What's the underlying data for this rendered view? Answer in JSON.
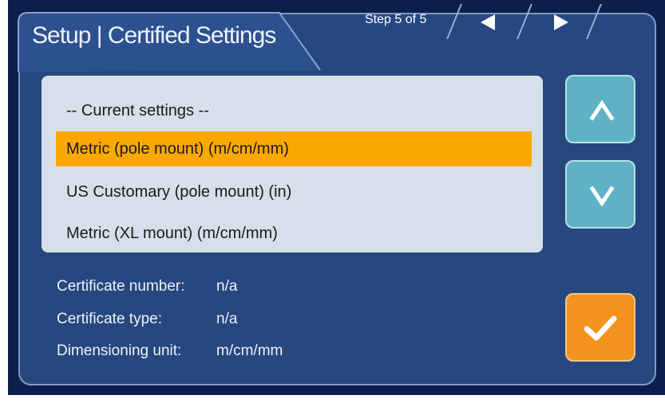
{
  "header": {
    "title": "Setup | Certified Settings",
    "step_indicator": "Step 5 of 5",
    "prev_icon": "triangle-left-icon",
    "next_icon": "triangle-right-icon"
  },
  "settings_list": {
    "items": [
      {
        "label": "-- Current settings --",
        "selected": false
      },
      {
        "label": "Metric (pole mount) (m/cm/mm)",
        "selected": true
      },
      {
        "label": "US Customary (pole mount) (in)",
        "selected": false
      },
      {
        "label": "Metric (XL mount) (m/cm/mm)",
        "selected": false
      }
    ]
  },
  "scroll_controls": {
    "up_icon": "chevron-up-icon",
    "down_icon": "chevron-down-icon"
  },
  "confirm": {
    "icon": "checkmark-icon"
  },
  "info": {
    "certificate_number_label": "Certificate number:",
    "certificate_number_value": "n/a",
    "certificate_type_label": "Certificate type:",
    "certificate_type_value": "n/a",
    "dimensioning_unit_label": "Dimensioning unit:",
    "dimensioning_unit_value": "m/cm/mm"
  },
  "colors": {
    "background": "#0c1f4a",
    "panel": "#27477f",
    "list_background": "#d7dfeb",
    "selected_row": "#fca800",
    "scroll_button": "#5fb2c5",
    "confirm_button": "#f3931f"
  }
}
